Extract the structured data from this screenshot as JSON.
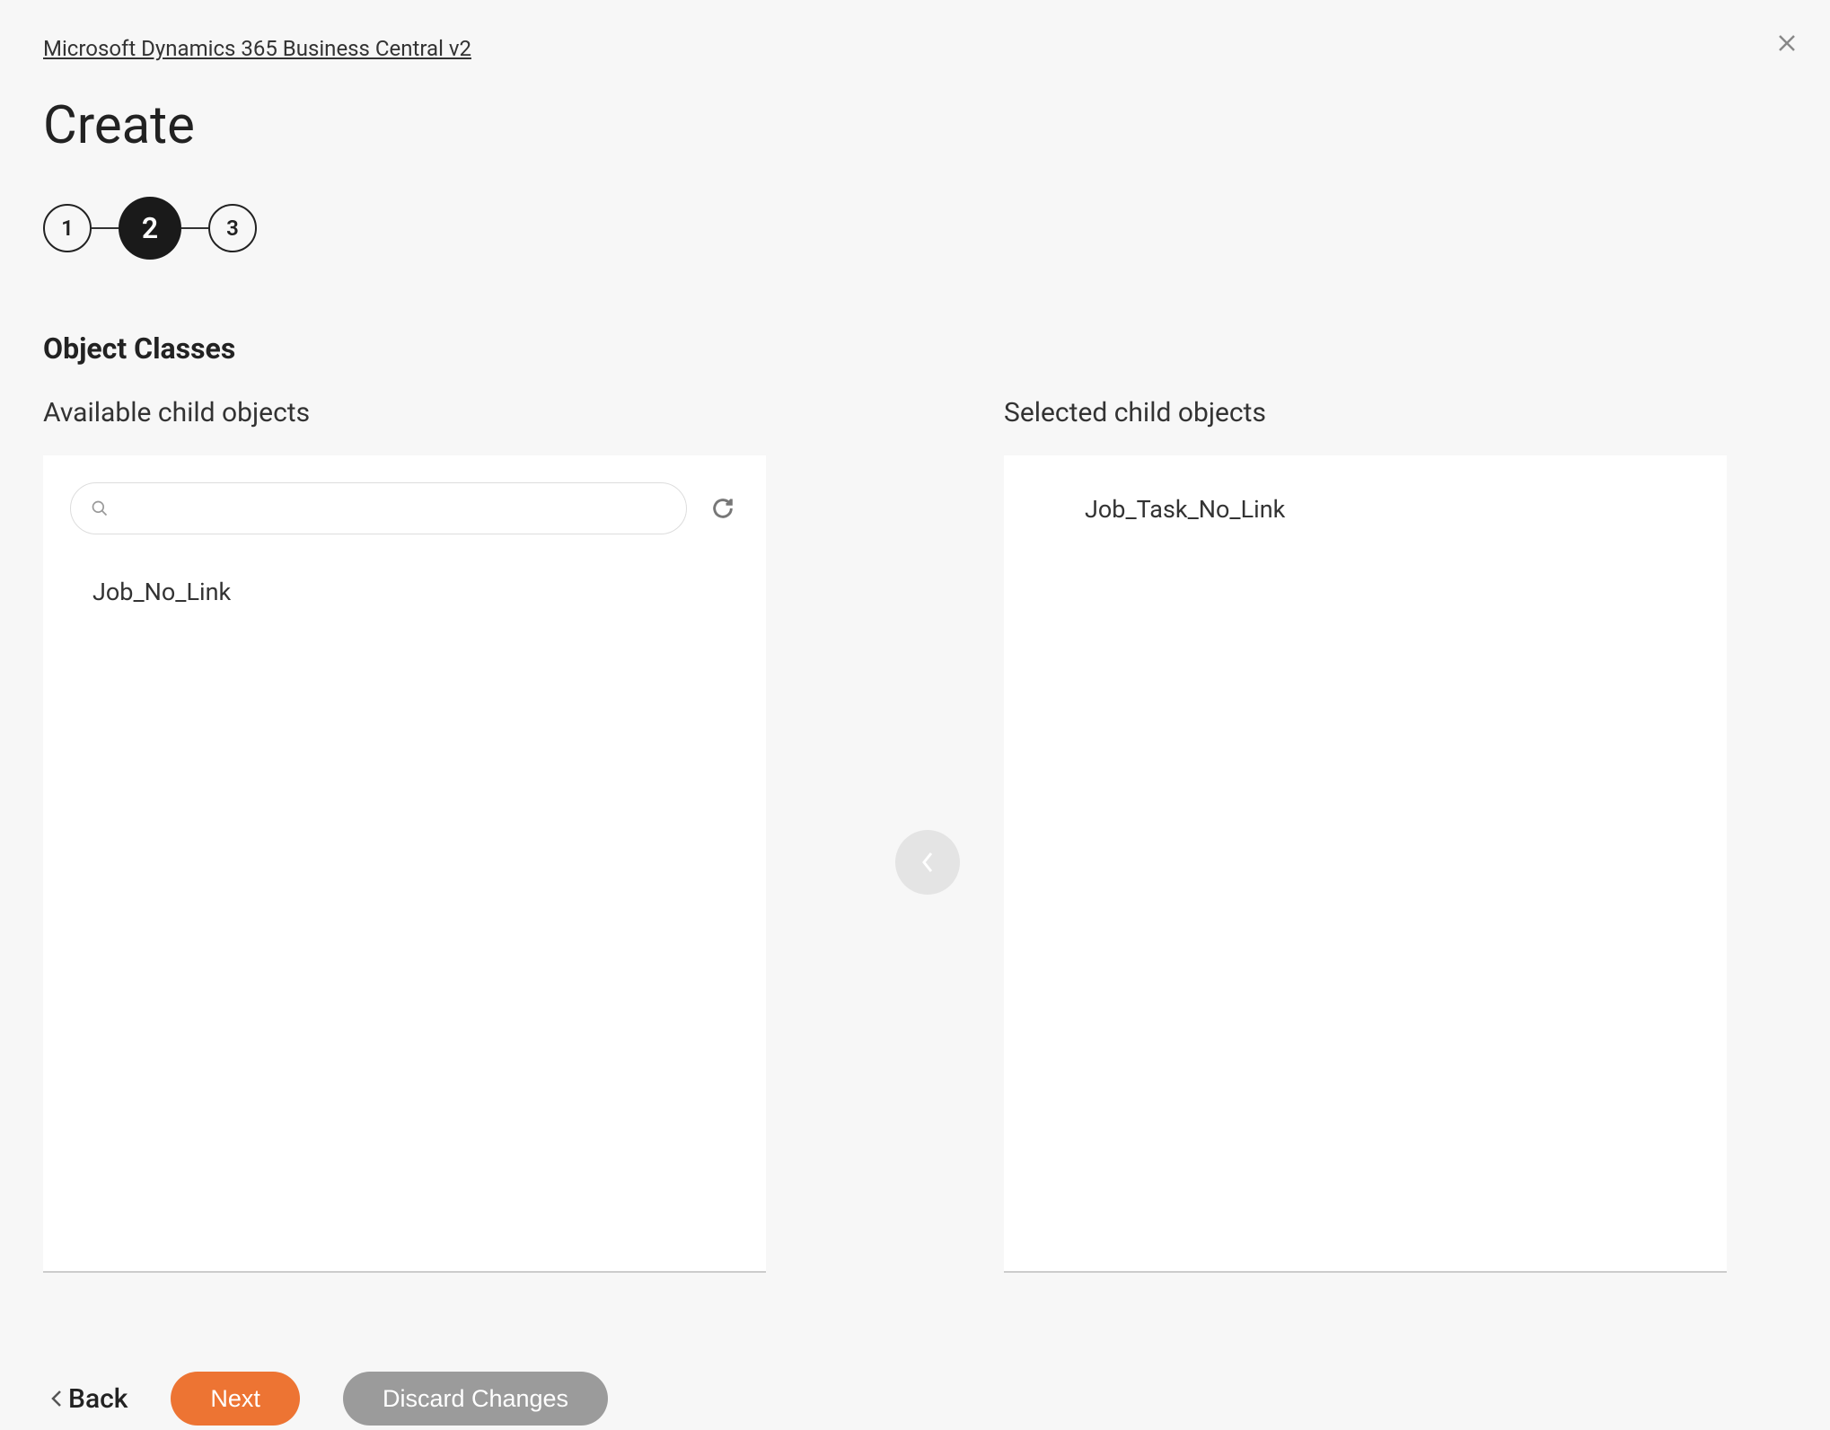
{
  "breadcrumb": "Microsoft Dynamics 365 Business Central v2",
  "page_title": "Create",
  "stepper": {
    "steps": [
      "1",
      "2",
      "3"
    ],
    "active_index": 1
  },
  "section_title": "Object Classes",
  "panels": {
    "available": {
      "label": "Available child objects",
      "search_value": "",
      "items": [
        "Job_No_Link"
      ]
    },
    "selected": {
      "label": "Selected child objects",
      "items": [
        "Job_Task_No_Link"
      ]
    }
  },
  "footer": {
    "back": "Back",
    "next": "Next",
    "discard": "Discard Changes"
  }
}
